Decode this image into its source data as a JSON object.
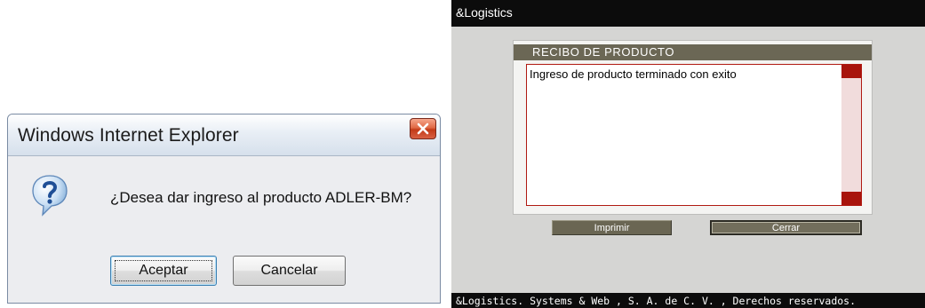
{
  "ie_dialog": {
    "title": "Windows Internet Explorer",
    "close_icon": "close-icon",
    "question_icon": "question-mark-icon",
    "message": "¿Desea dar ingreso al producto ADLER-BM?",
    "accept_label": "Aceptar",
    "cancel_label": "Cancelar",
    "colors": {
      "close_button": "#c33a17",
      "icon_blue": "#2f6fb8"
    }
  },
  "logistics": {
    "app_title": "&Logistics",
    "panel": {
      "title": "RECIBO DE PRODUCTO",
      "message": "Ingreso de producto terminado con exito"
    },
    "buttons": {
      "print_label": "Imprimir",
      "close_label": "Cerrar"
    },
    "footer": "&Logistics. Systems & Web , S. A. de C. V. , Derechos reservados.",
    "colors": {
      "header_bg": "#0c0c0c",
      "panel_title_bg": "#6b6755",
      "accent_red": "#a8140c",
      "window_bg": "#d5d5d3"
    }
  }
}
